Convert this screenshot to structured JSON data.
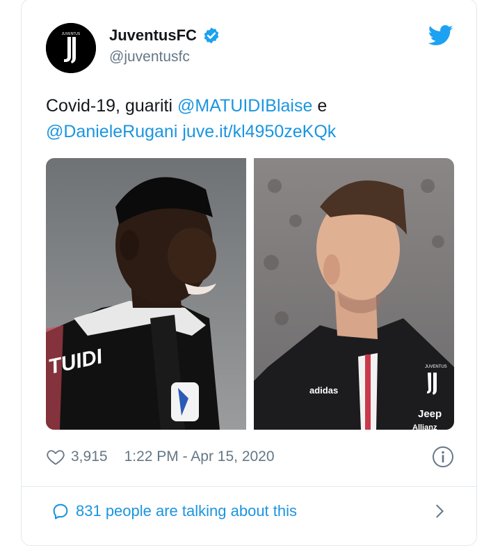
{
  "tweet": {
    "display_name": "JuventusFC",
    "handle": "@juventusfc",
    "text_prefix": "Covid-19, guariti ",
    "mention_1": "@MATUIDIBlaise",
    "text_middle": " e",
    "mention_2": "@DanieleRugani",
    "link": "juve.it/kl4950zeKQk",
    "like_count": "3,915",
    "timestamp": "1:22 PM - Apr 15, 2020",
    "talking_text": "831 people are talking about this"
  },
  "images": {
    "left_jersey_text": "TUIDI",
    "right_badge_text": "JUVENTUS",
    "right_sponsor_text": "Jeep",
    "right_brand_text": "adidas",
    "right_allianz_text": "Allianz"
  },
  "colors": {
    "link": "#1b95e0",
    "verified": "#1da1f2",
    "muted": "#657786"
  },
  "icons": [
    "juventus-logo-icon",
    "verified-badge-icon",
    "twitter-bird-icon",
    "heart-icon",
    "info-icon",
    "speech-bubble-icon",
    "chevron-right-icon"
  ]
}
